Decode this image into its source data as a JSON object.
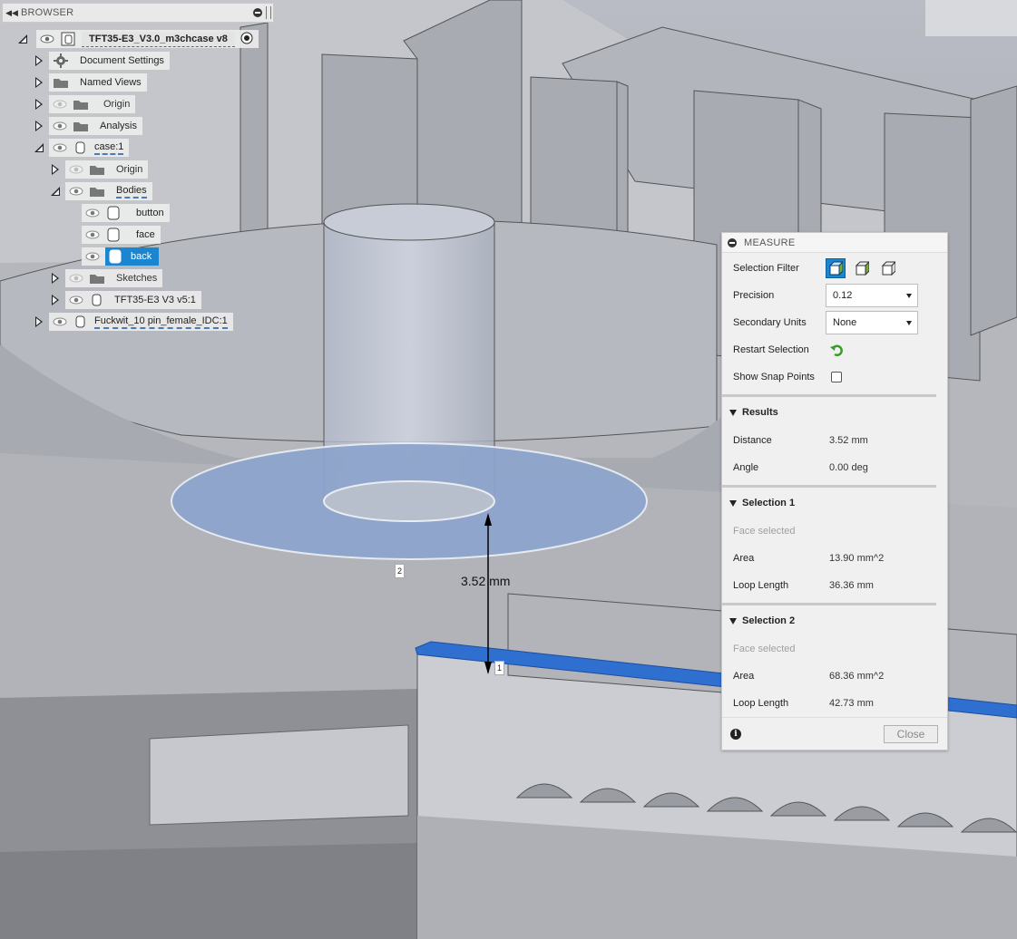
{
  "browser": {
    "title": "BROWSER",
    "items": [
      {
        "label": "TFT35-E3_V3.0_m3chcase v8"
      },
      {
        "label": "Document Settings"
      },
      {
        "label": "Named Views"
      },
      {
        "label": "Origin"
      },
      {
        "label": "Analysis"
      },
      {
        "label": "case:1"
      },
      {
        "label": "Origin"
      },
      {
        "label": "Bodies"
      },
      {
        "label": "button"
      },
      {
        "label": "face"
      },
      {
        "label": "back"
      },
      {
        "label": "Sketches"
      },
      {
        "label": "TFT35-E3 V3 v5:1"
      },
      {
        "label": "Fuckwit_10 pin_female_IDC:1"
      }
    ]
  },
  "measure": {
    "title": "MEASURE",
    "selection_filter_label": "Selection Filter",
    "precision_label": "Precision",
    "precision_value": "0.12",
    "secondary_units_label": "Secondary Units",
    "secondary_units_value": "None",
    "restart_selection_label": "Restart Selection",
    "show_snap_points_label": "Show Snap Points",
    "results": {
      "title": "Results",
      "distance_label": "Distance",
      "distance_value": "3.52 mm",
      "angle_label": "Angle",
      "angle_value": "0.00 deg"
    },
    "selection1": {
      "title": "Selection 1",
      "status": "Face selected",
      "area_label": "Area",
      "area_value": "13.90 mm^2",
      "loop_label": "Loop Length",
      "loop_value": "36.36 mm"
    },
    "selection2": {
      "title": "Selection 2",
      "status": "Face selected",
      "area_label": "Area",
      "area_value": "68.36 mm^2",
      "loop_label": "Loop Length",
      "loop_value": "42.73 mm"
    },
    "close_label": "Close"
  },
  "viewport": {
    "dimension_label": "3.52 mm",
    "point1_label": "1",
    "point2_label": "2"
  },
  "colors": {
    "accent": "#1a86d0",
    "highlight_face": "#2e6fd0",
    "selected_face": "#8ea5cc"
  }
}
